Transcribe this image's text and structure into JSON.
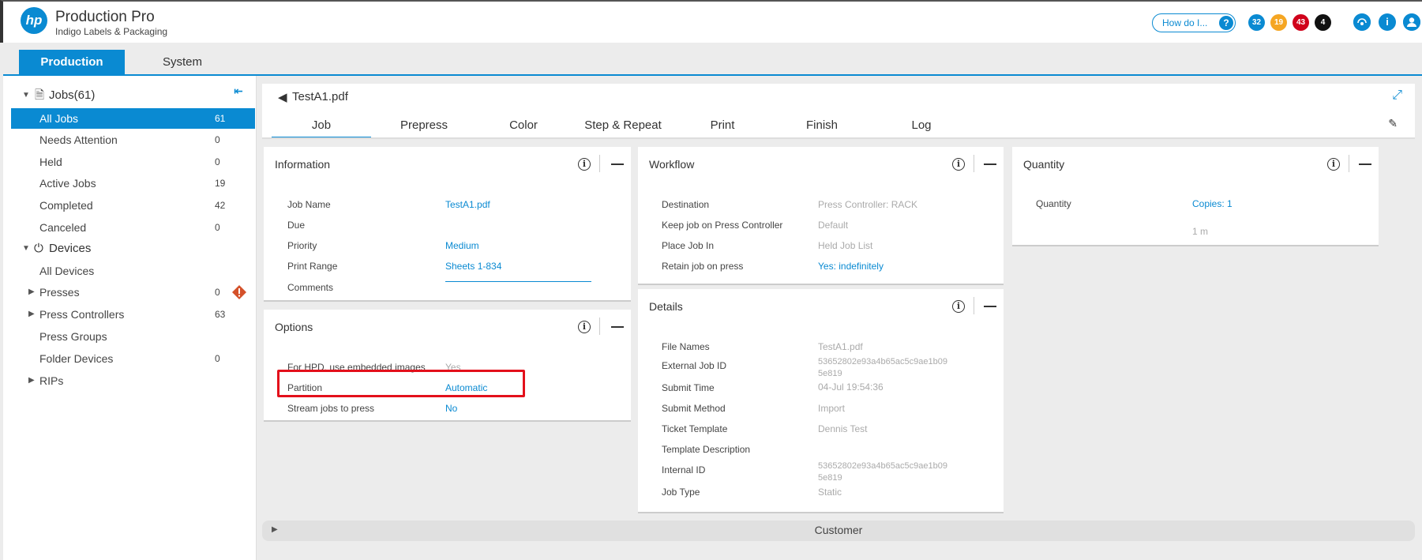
{
  "header": {
    "logo": "hp",
    "app_name": "Production Pro",
    "app_subtitle": "Indigo Labels & Packaging",
    "howdo_label": "How do I...",
    "howdo_icon": "?",
    "badges": [
      {
        "value": "32",
        "color": "#0a8ad2"
      },
      {
        "value": "19",
        "color": "#f5a623"
      },
      {
        "value": "43",
        "color": "#d0021b"
      },
      {
        "value": "4",
        "color": "#111111"
      }
    ],
    "icons": [
      "printer-status-icon",
      "info-icon",
      "user-icon"
    ]
  },
  "topnav": {
    "tabs": [
      {
        "label": "Production",
        "active": true
      },
      {
        "label": "System",
        "active": false
      }
    ]
  },
  "sidebar": {
    "jobs_header": "Jobs(61)",
    "jobs": [
      {
        "label": "All Jobs",
        "count": "61",
        "active": true
      },
      {
        "label": "Needs Attention",
        "count": "0"
      },
      {
        "label": "Held",
        "count": "0"
      },
      {
        "label": "Active Jobs",
        "count": "19"
      },
      {
        "label": "Completed",
        "count": "42"
      },
      {
        "label": "Canceled",
        "count": "0"
      }
    ],
    "devices_header": "Devices",
    "devices": [
      {
        "label": "All Devices",
        "count": ""
      },
      {
        "label": "Presses",
        "count": "0"
      },
      {
        "label": "Press Controllers",
        "count": "63"
      },
      {
        "label": "Press Groups",
        "count": ""
      },
      {
        "label": "Folder Devices",
        "count": "0"
      },
      {
        "label": "RIPs",
        "count": ""
      }
    ]
  },
  "job": {
    "title": "TestA1.pdf",
    "tabs": [
      "Job",
      "Prepress",
      "Color",
      "Step & Repeat",
      "Print",
      "Finish",
      "Log"
    ],
    "active_tab": "Job"
  },
  "information": {
    "title": "Information",
    "rows": [
      {
        "key": "Job Name",
        "value": "TestA1.pdf"
      },
      {
        "key": "Due",
        "value": ""
      },
      {
        "key": "Priority",
        "value": "Medium"
      },
      {
        "key": "Print Range",
        "value": "Sheets 1-834"
      },
      {
        "key": "Comments",
        "value": ""
      }
    ]
  },
  "options": {
    "title": "Options",
    "rows": [
      {
        "key": "For HPD, use embedded images",
        "value": "Yes"
      },
      {
        "key": "Partition",
        "value": "Automatic"
      },
      {
        "key": "Stream jobs to press",
        "value": "No"
      }
    ]
  },
  "workflow": {
    "title": "Workflow",
    "rows": [
      {
        "key": "Destination",
        "value": "Press Controller: RACK"
      },
      {
        "key": "Keep job on Press Controller",
        "value": "Default"
      },
      {
        "key": "Place Job In",
        "value": "Held Job List"
      },
      {
        "key": "Retain job on press",
        "value": "Yes: indefinitely"
      }
    ]
  },
  "details": {
    "title": "Details",
    "rows": [
      {
        "key": "File Names",
        "value": "TestA1.pdf"
      },
      {
        "key": "External Job ID",
        "value": "53652802e93a4b65ac5c9ae1b09\n5e819"
      },
      {
        "key": "Submit Time",
        "value": "04-Jul 19:54:36"
      },
      {
        "key": "Submit Method",
        "value": "Import"
      },
      {
        "key": "Ticket Template",
        "value": "Dennis Test"
      },
      {
        "key": "Template Description",
        "value": ""
      },
      {
        "key": "Internal ID",
        "value": "53652802e93a4b65ac5c9ae1b09\n5e819"
      },
      {
        "key": "Job Type",
        "value": "Static"
      }
    ]
  },
  "quantity": {
    "title": "Quantity",
    "rows": [
      {
        "key": "Quantity",
        "value": "Copies: 1"
      },
      {
        "key": "",
        "value": "1 m"
      }
    ]
  },
  "customer": {
    "label": "Customer"
  }
}
